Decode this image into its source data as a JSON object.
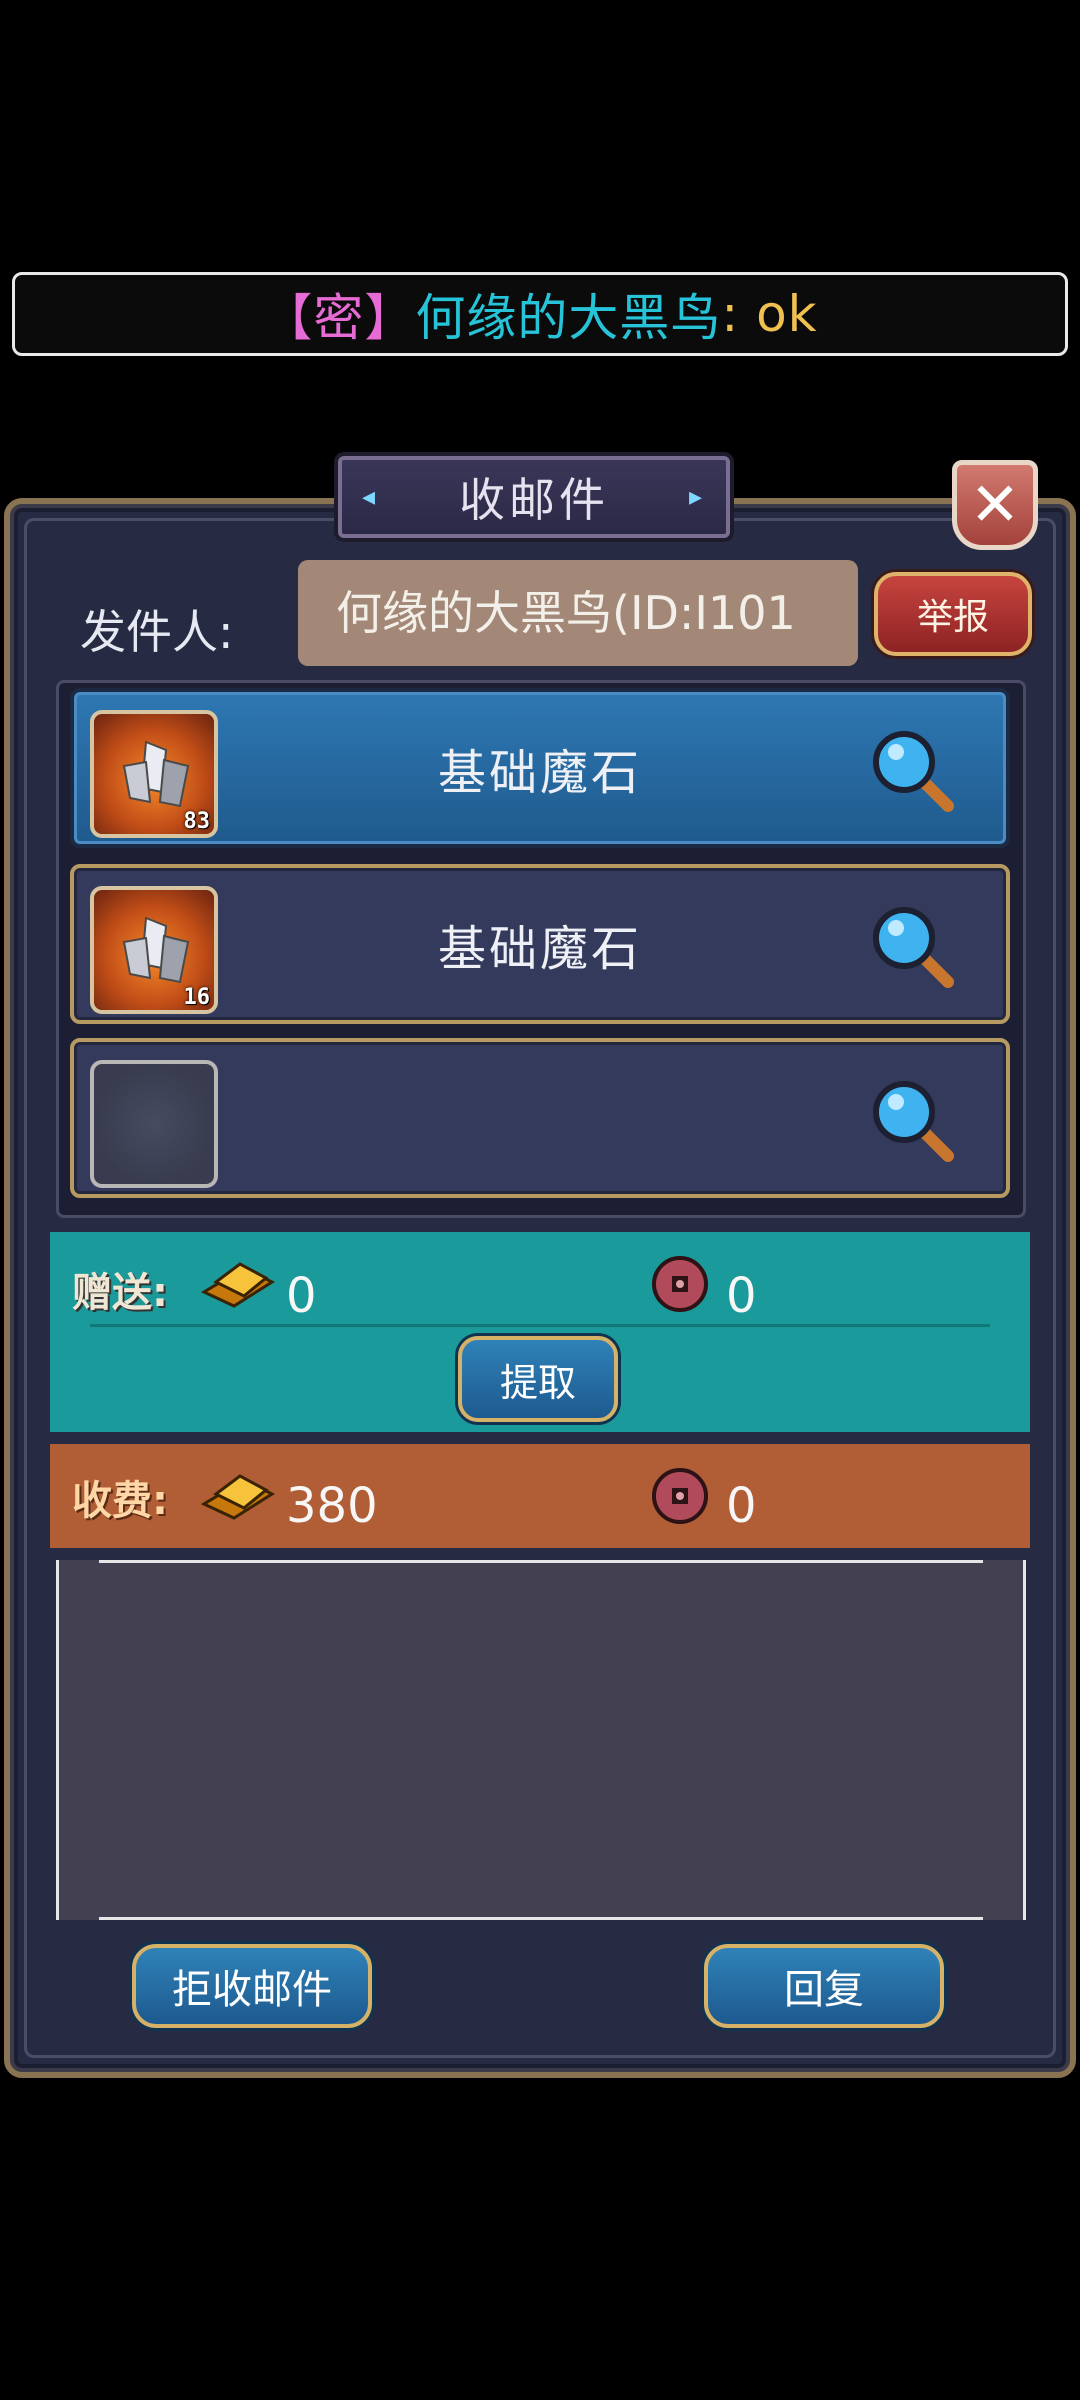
{
  "chat": {
    "tag": "【密】",
    "sender": "何缘的大黑鸟",
    "message": ": ok"
  },
  "mail": {
    "title": "收邮件",
    "close": "✕",
    "sender_label": "发件人:",
    "sender_value": "何缘的大黑鸟(ID:I101",
    "report_label": "举报",
    "attachments": [
      {
        "name": "基础魔石",
        "qty": "83",
        "selected": true
      },
      {
        "name": "基础魔石",
        "qty": "16",
        "selected": false
      },
      {
        "name": "",
        "qty": "",
        "selected": false
      }
    ],
    "gift": {
      "label": "赠送:",
      "gold": "0",
      "coin": "0",
      "claim_label": "提取"
    },
    "fee": {
      "label": "收费:",
      "gold": "380",
      "coin": "0"
    },
    "buttons": {
      "reject": "拒收邮件",
      "reply": "回复"
    }
  },
  "colors": {
    "chat_tag": "#e66bd4",
    "chat_name": "#27c3d8",
    "chat_msg": "#f0c050",
    "gift_band": "#1a9a9a",
    "fee_band": "#b15d35"
  }
}
